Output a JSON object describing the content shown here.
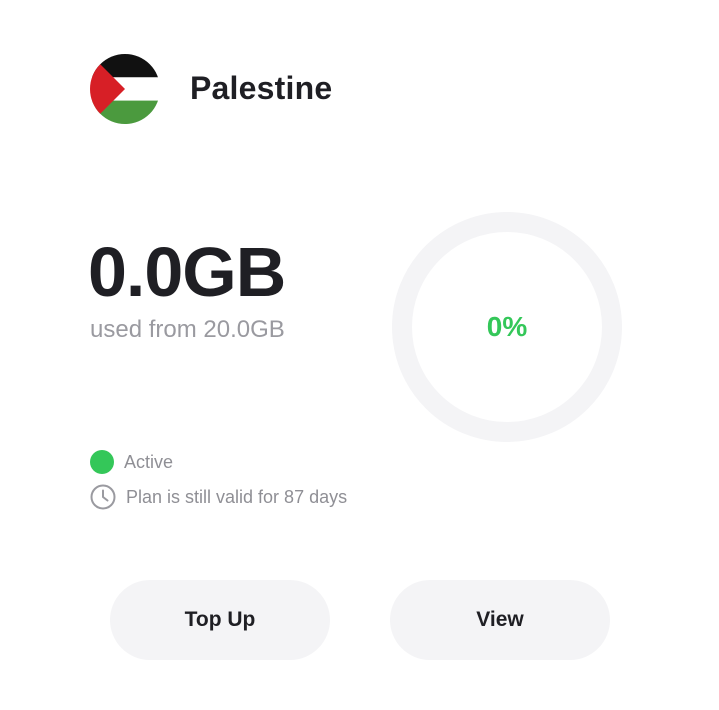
{
  "header": {
    "country_name": "Palestine",
    "flag_icon": "palestine-flag-icon"
  },
  "usage": {
    "used_amount": "0.0GB",
    "used_from_text": "used from 20.0GB",
    "percent_label": "0%",
    "percent_value": 0,
    "progress_color": "#34c759",
    "track_color": "#f4f4f6"
  },
  "status": {
    "label": "Active",
    "color": "#34c759",
    "validity_text": "Plan is still valid for 87 days",
    "validity_icon": "clock-icon"
  },
  "actions": {
    "top_up_label": "Top Up",
    "view_label": "View"
  }
}
